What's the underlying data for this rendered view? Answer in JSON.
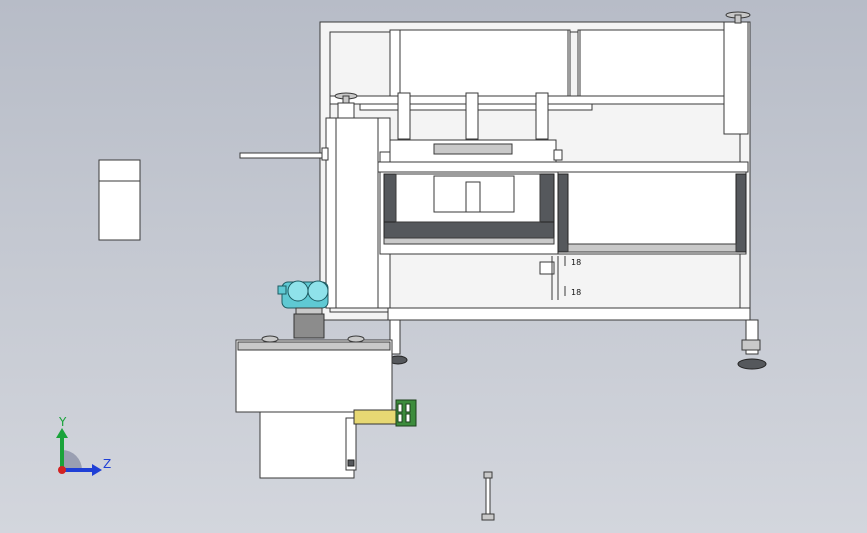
{
  "view": {
    "background_top": "#b7bcc7",
    "background_bottom": "#d3d6dd"
  },
  "triad": {
    "y_label": "Y",
    "z_label": "Z",
    "y_color": "#1aa33a",
    "z_color": "#1f3fd6",
    "origin_color": "#d22222"
  },
  "labels": {
    "dim_upper": "18",
    "dim_lower": "18"
  },
  "colors": {
    "cyan_part": "#5fc9d3",
    "green_connector": "#3c8c3c",
    "yellow_terminal": "#e7d873",
    "dark_frame": "#55585c"
  }
}
